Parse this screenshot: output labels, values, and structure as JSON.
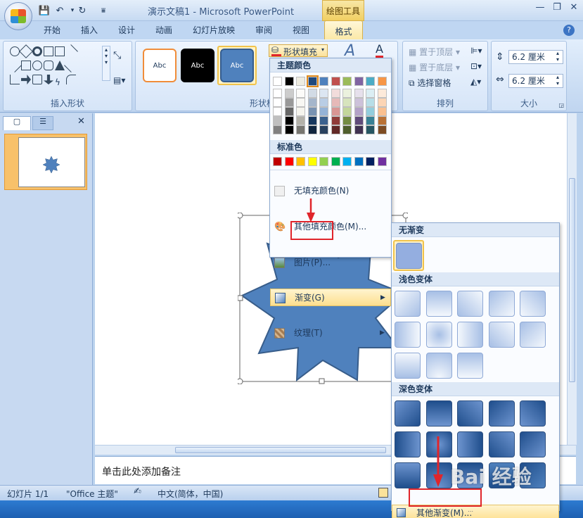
{
  "titlebar": {
    "title": "演示文稿1 - Microsoft PowerPoint",
    "context_tab_group": "绘图工具",
    "qat_sep": "="
  },
  "tabs": [
    "开始",
    "插入",
    "设计",
    "动画",
    "幻灯片放映",
    "审阅",
    "视图"
  ],
  "active_tab": "格式",
  "ribbon": {
    "insert_shapes_label": "插入形状",
    "shape_styles_label": "形状样式",
    "style_sample_text": "Abc",
    "shape_fill_label": "形状填充",
    "arrange_label": "排列",
    "bring_front": "置于顶层",
    "send_back": "置于底层",
    "selection_pane": "选择窗格",
    "size_label": "大小",
    "height_value": "6.2 厘米",
    "width_value": "6.2 厘米"
  },
  "fill_menu": {
    "theme_colors_header": "主题颜色",
    "standard_colors_header": "标准色",
    "no_fill": "无填充颜色(N)",
    "more_colors": "其他填充颜色(M)...",
    "picture": "图片(P)...",
    "gradient": "渐变(G)",
    "texture": "纹理(T)",
    "theme_top_row": [
      "#ffffff",
      "#000000",
      "#eeece1",
      "#1f497d",
      "#4f81bd",
      "#c0504d",
      "#9bbb59",
      "#8064a2",
      "#4bacc6",
      "#f79646"
    ],
    "standard_colors": [
      "#c00000",
      "#ff0000",
      "#ffc000",
      "#ffff00",
      "#92d050",
      "#00b050",
      "#00b0f0",
      "#0070c0",
      "#002060",
      "#7030a0"
    ]
  },
  "gradient_menu": {
    "no_gradient_header": "无渐变",
    "light_header": "浅色变体",
    "dark_header": "深色变体",
    "more_gradients": "其他渐变(M)..."
  },
  "thumbnail": {
    "slide_number": "1"
  },
  "notes_placeholder": "单击此处添加备注",
  "status": {
    "slide_count": "幻灯片 1/1",
    "theme": "\"Office 主题\"",
    "language": "中文(简体，中国)"
  },
  "watermark": "Bai 经验"
}
